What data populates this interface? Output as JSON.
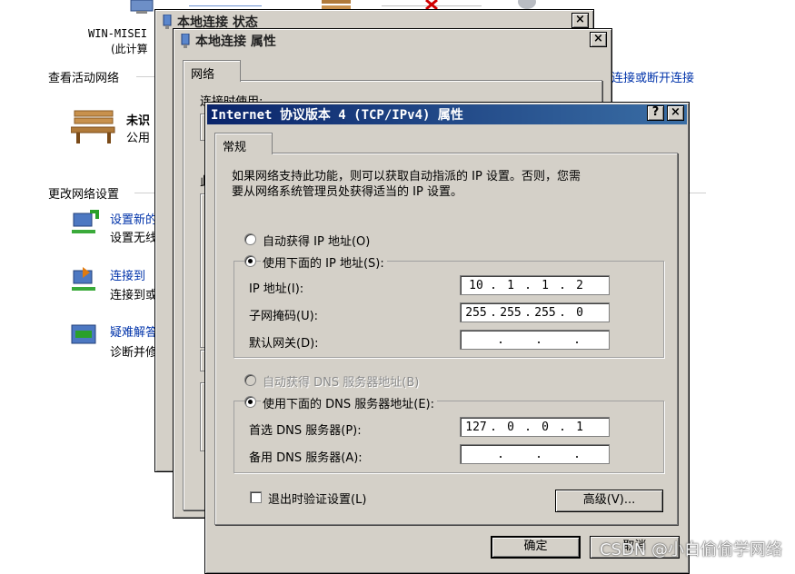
{
  "background": {
    "computer_name": "WIN-MISEI",
    "computer_sub": "(此计算",
    "view_active_networks": "查看活动网络",
    "connect_disconnect": "连接或断开连接",
    "network_name": "未识",
    "network_type": "公用",
    "change_settings": "更改网络设置",
    "items": [
      {
        "title": "设置新的",
        "desc": "设置无线"
      },
      {
        "title": "连接到",
        "desc": "连接到或"
      },
      {
        "title": "疑难解答",
        "desc": "诊断并修"
      }
    ]
  },
  "status_dialog": {
    "title": "本地连接 状态",
    "close": "×"
  },
  "props_dialog": {
    "title": "本地连接 属性",
    "close": "×",
    "tab": "网络",
    "connect_using": "连接时使用:",
    "partial_char": "此"
  },
  "ipv4_dialog": {
    "title": "Internet 协议版本 4 (TCP/IPv4) 属性",
    "help": "?",
    "close": "×",
    "tab": "常规",
    "description_line1": "如果网络支持此功能，则可以获取自动指派的 IP 设置。否则，您需",
    "description_line2": "要从网络系统管理员处获得适当的 IP 设置。",
    "auto_ip": "自动获得 IP 地址(O)",
    "manual_ip": "使用下面的 IP 地址(S):",
    "ip_label": "IP 地址(I):",
    "mask_label": "子网掩码(U):",
    "gateway_label": "默认网关(D):",
    "ip_address": [
      "10",
      "1",
      "1",
      "2"
    ],
    "subnet_mask": [
      "255",
      "255",
      "255",
      "0"
    ],
    "gateway": [
      "",
      "",
      "",
      ""
    ],
    "auto_dns": "自动获得 DNS 服务器地址(B)",
    "manual_dns": "使用下面的 DNS 服务器地址(E):",
    "preferred_dns_label": "首选 DNS 服务器(P):",
    "alternate_dns_label": "备用 DNS 服务器(A):",
    "preferred_dns": [
      "127",
      "0",
      "0",
      "1"
    ],
    "alternate_dns": [
      "",
      "",
      "",
      ""
    ],
    "validate_on_exit": "退出时验证设置(L)",
    "advanced": "高级(V)...",
    "ok": "确定",
    "cancel": "取消"
  },
  "watermark": "CSDN @小白偷偷学网络",
  "colors": {
    "titlebar_start": "#0a246a",
    "titlebar_end": "#3a6ea5",
    "dialog_face": "#d4d0c8",
    "link": "#0033aa"
  }
}
